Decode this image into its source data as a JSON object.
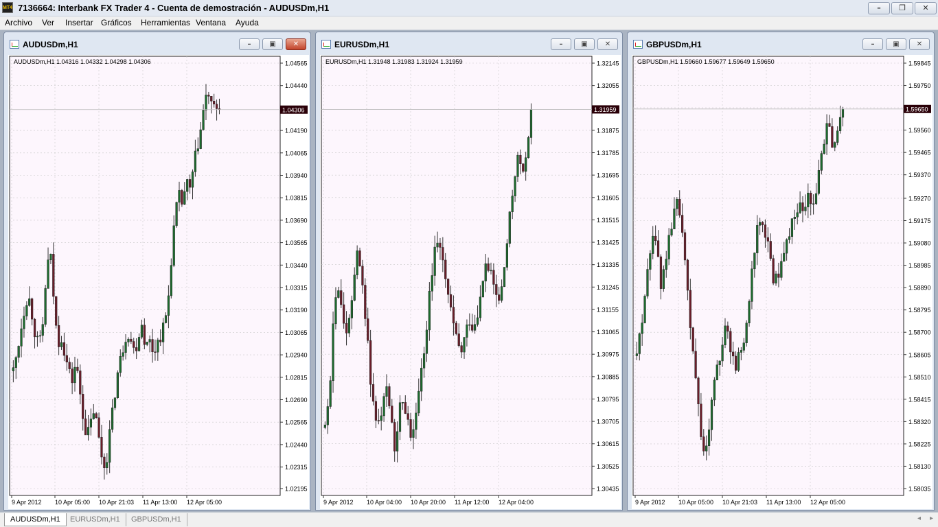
{
  "app": {
    "title": "7136664: Interbank FX Trader 4 - Cuenta de demostración - AUDUSDm,H1",
    "icon_label": "MT4"
  },
  "window_controls": {
    "minimize": "minimize-icon",
    "restore": "restore-icon",
    "close": "close-icon"
  },
  "menu": [
    "Archivo",
    "Ver",
    "Insertar",
    "Gráficos",
    "Herramientas",
    "Ventana",
    "Ayuda"
  ],
  "colors": {
    "bull": "#1d6b2e",
    "bear": "#6b1d2a",
    "chart_bg": "#fdf6fd",
    "grid": "#c8c8c8",
    "price_tag_bg": "#2a0008"
  },
  "charts": [
    {
      "window_title": "AUDUSDm,H1",
      "info": "AUDUSDm,H1  1.04316 1.04332 1.04298 1.04306",
      "price_tag": "1.04306",
      "current": 1.04306,
      "y_labels": [
        "1.04565",
        "1.04440",
        "1.04190",
        "1.04065",
        "1.03940",
        "1.03815",
        "1.03690",
        "1.03565",
        "1.03440",
        "1.03315",
        "1.03190",
        "1.03065",
        "1.02940",
        "1.02815",
        "1.02690",
        "1.02565",
        "1.02440",
        "1.02315",
        "1.02195"
      ],
      "y_min": 1.02195,
      "y_max": 1.04565,
      "x_labels": [
        "9 Apr 2012",
        "10 Apr 05:00",
        "10 Apr 21:03",
        "11 Apr 13:00",
        "12 Apr 05:00"
      ],
      "close_path": [
        1.0285,
        1.0295,
        1.0308,
        1.032,
        1.0328,
        1.0318,
        1.0305,
        1.0298,
        1.031,
        1.034,
        1.0352,
        1.0325,
        1.03,
        1.0305,
        1.0295,
        1.0285,
        1.028,
        1.029,
        1.0275,
        1.026,
        1.0248,
        1.0255,
        1.0265,
        1.025,
        1.0238,
        1.023,
        1.0248,
        1.0262,
        1.028,
        1.029,
        1.03,
        1.0308,
        1.0302,
        1.0295,
        1.0305,
        1.0312,
        1.0298,
        1.0302,
        1.0296,
        1.03,
        1.0305,
        1.031,
        1.0322,
        1.035,
        1.0372,
        1.0382,
        1.0378,
        1.039,
        1.0385,
        1.0398,
        1.041,
        1.042,
        1.0435,
        1.044,
        1.043,
        1.0432,
        1.04306
      ]
    },
    {
      "window_title": "EURUSDm,H1",
      "info": "EURUSDm,H1  1.31948 1.31983 1.31924 1.31959",
      "price_tag": "1.31959",
      "current": 1.31959,
      "y_labels": [
        "1.32145",
        "1.32055",
        "1.31875",
        "1.31785",
        "1.31695",
        "1.31605",
        "1.31515",
        "1.31425",
        "1.31335",
        "1.31245",
        "1.31155",
        "1.31065",
        "1.30975",
        "1.30885",
        "1.30795",
        "1.30705",
        "1.30615",
        "1.30525",
        "1.30435"
      ],
      "y_min": 1.30435,
      "y_max": 1.32145,
      "x_labels": [
        "9 Apr 2012",
        "10 Apr 04:00",
        "10 Apr 20:00",
        "11 Apr 12:00",
        "12 Apr 04:00"
      ],
      "close_path": [
        1.3068,
        1.308,
        1.311,
        1.3125,
        1.3115,
        1.3105,
        1.311,
        1.313,
        1.314,
        1.3125,
        1.311,
        1.3085,
        1.3075,
        1.3068,
        1.3078,
        1.3088,
        1.307,
        1.306,
        1.3075,
        1.308,
        1.3072,
        1.3065,
        1.3075,
        1.3085,
        1.31,
        1.3115,
        1.313,
        1.3145,
        1.314,
        1.3128,
        1.312,
        1.311,
        1.3102,
        1.3098,
        1.3105,
        1.3112,
        1.3108,
        1.3115,
        1.3122,
        1.3135,
        1.313,
        1.3125,
        1.3118,
        1.3125,
        1.314,
        1.3155,
        1.317,
        1.3178,
        1.3168,
        1.3182,
        1.31959
      ]
    },
    {
      "window_title": "GBPUSDm,H1",
      "info": "GBPUSDm,H1  1.59660 1.59677 1.59649 1.59650",
      "price_tag": "1.59650",
      "current": 1.5965,
      "y_labels": [
        "1.59845",
        "1.59750",
        "1.59655",
        "1.59560",
        "1.59465",
        "1.59370",
        "1.59270",
        "1.59175",
        "1.59080",
        "1.58985",
        "1.58890",
        "1.58795",
        "1.58700",
        "1.58605",
        "1.58510",
        "1.58415",
        "1.58320",
        "1.58225",
        "1.58130",
        "1.58035"
      ],
      "y_min": 1.58035,
      "y_max": 1.59845,
      "x_labels": [
        "9 Apr 2012",
        "10 Apr 05:00",
        "10 Apr 21:03",
        "11 Apr 13:00",
        "12 Apr 05:00"
      ],
      "close_path": [
        1.586,
        1.5875,
        1.5895,
        1.591,
        1.5905,
        1.589,
        1.59,
        1.5915,
        1.5925,
        1.592,
        1.59,
        1.587,
        1.585,
        1.583,
        1.5815,
        1.5835,
        1.585,
        1.586,
        1.587,
        1.5865,
        1.5855,
        1.586,
        1.587,
        1.5885,
        1.5905,
        1.592,
        1.5915,
        1.5905,
        1.589,
        1.5895,
        1.5905,
        1.591,
        1.592,
        1.5925,
        1.5918,
        1.593,
        1.5925,
        1.5935,
        1.595,
        1.596,
        1.5945,
        1.5955,
        1.5965
      ]
    }
  ],
  "tabs": [
    "AUDUSDm,H1",
    "EURUSDm,H1",
    "GBPUSDm,H1"
  ],
  "tab_arrows": {
    "left": "tab-scroll-left-icon",
    "right": "tab-scroll-right-icon"
  }
}
